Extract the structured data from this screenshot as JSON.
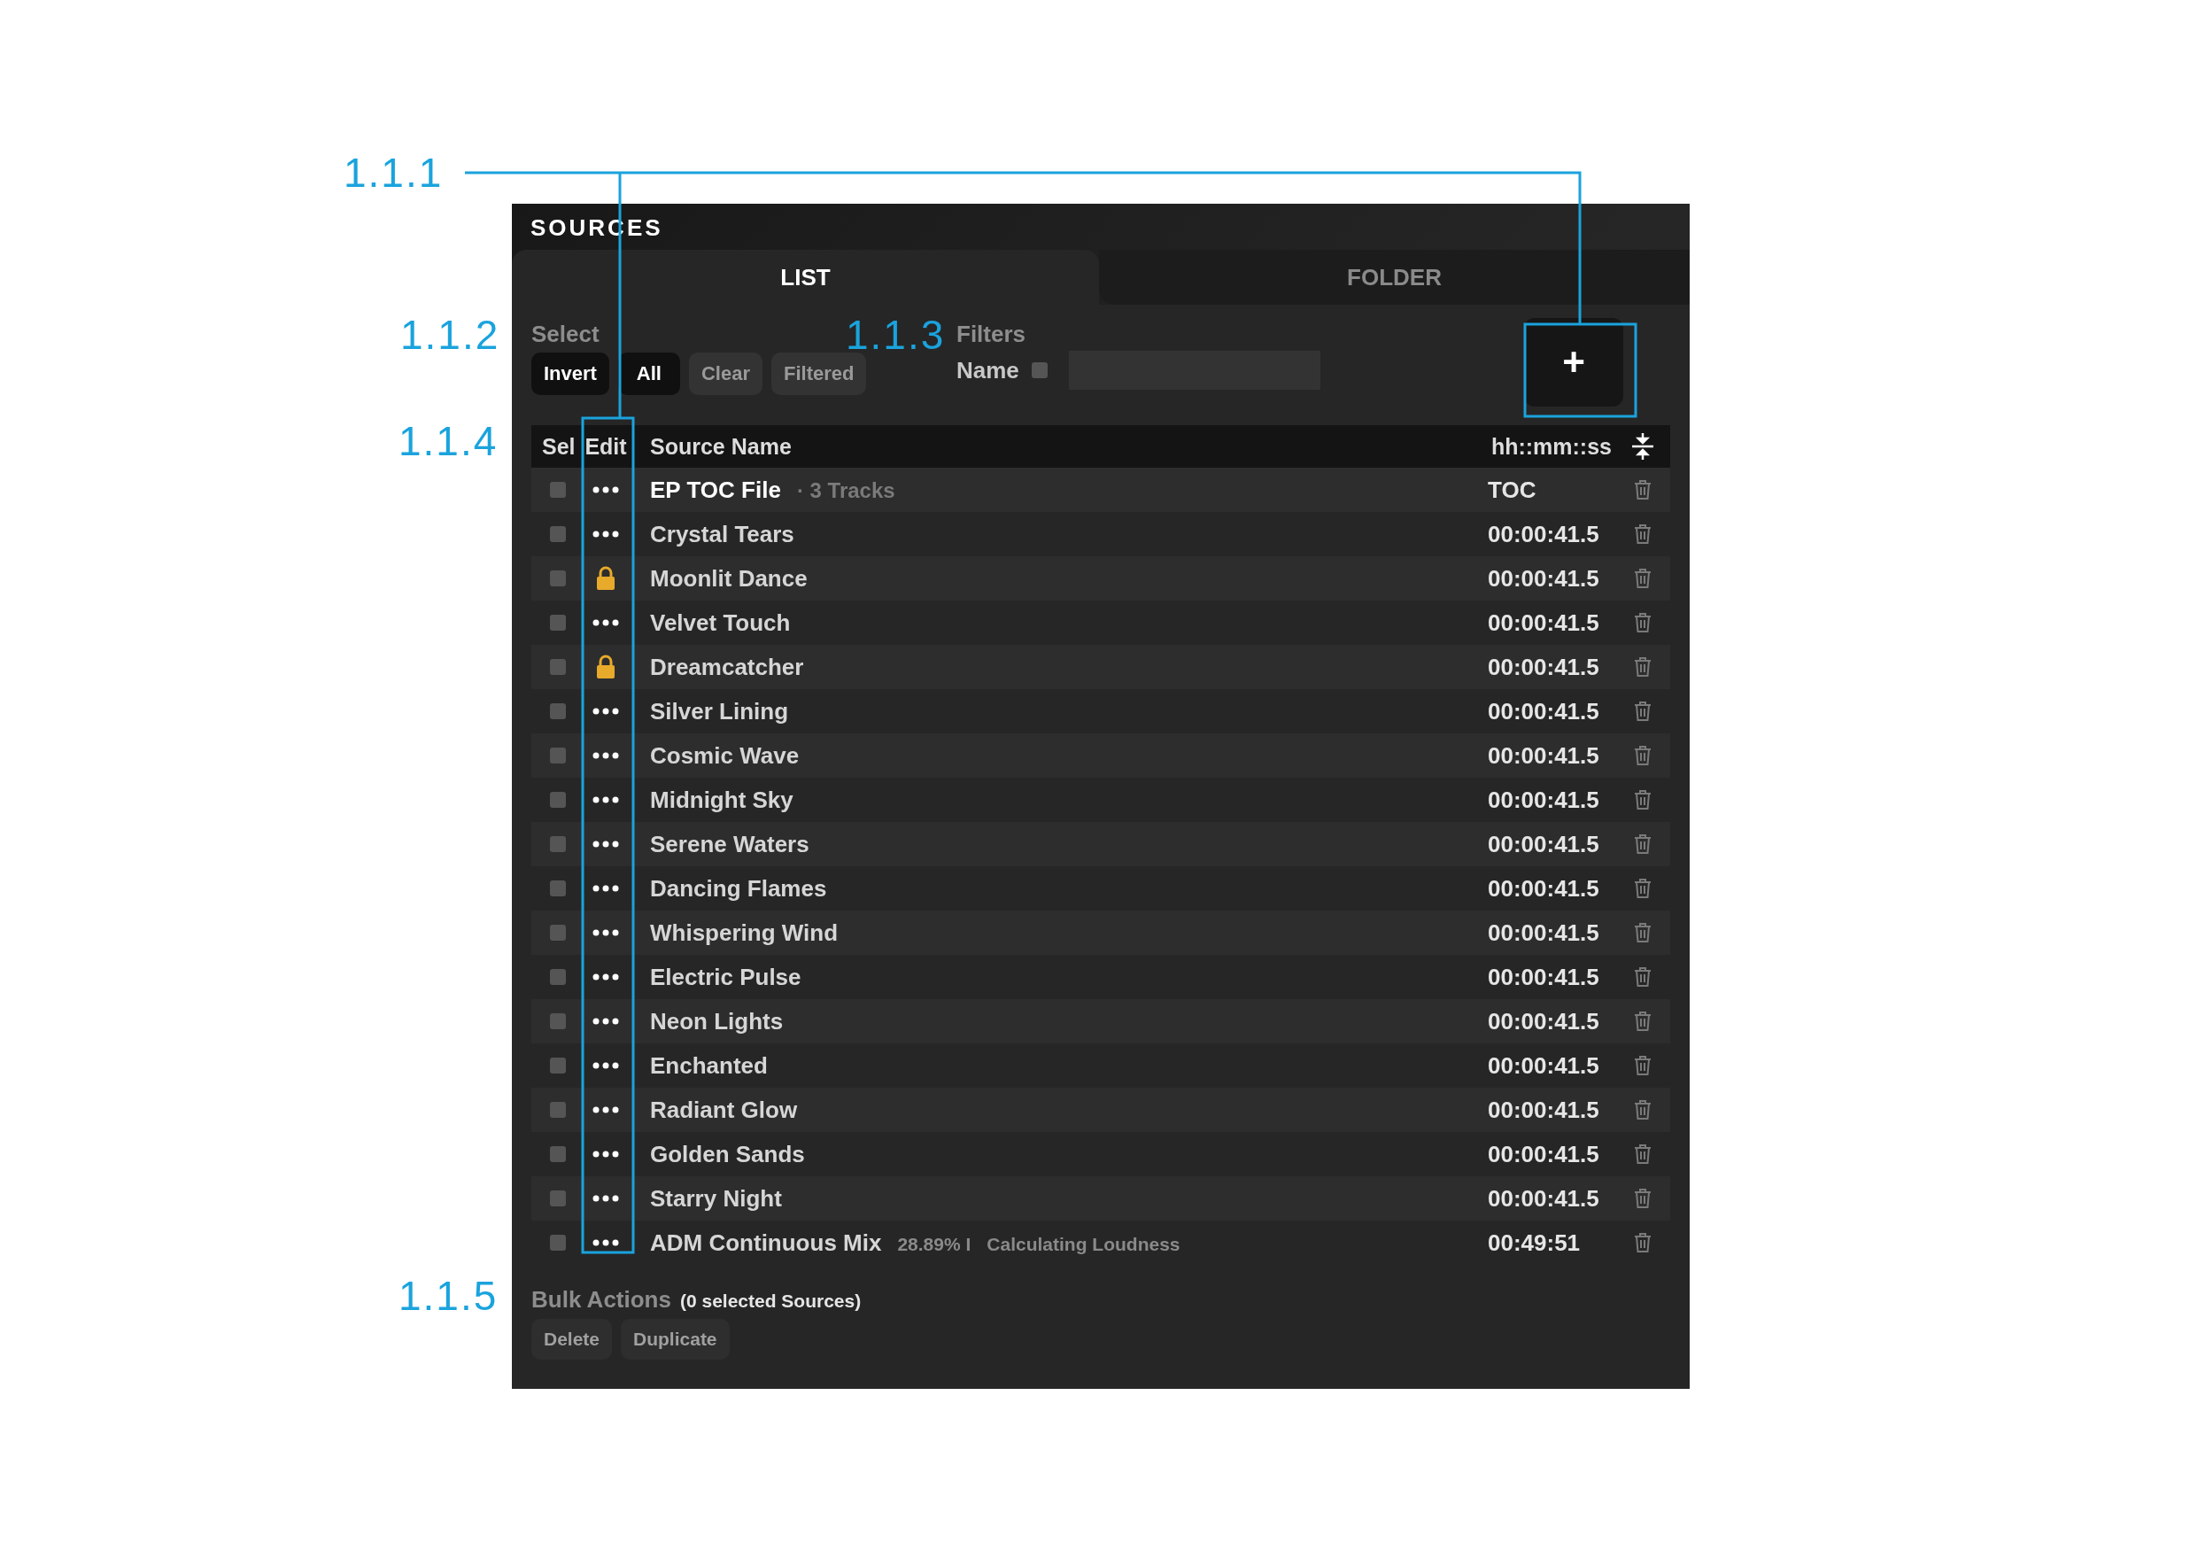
{
  "callouts": [
    {
      "label": "1.1.1"
    },
    {
      "label": "1.1.2"
    },
    {
      "label": "1.1.3"
    },
    {
      "label": "1.1.4"
    },
    {
      "label": "1.1.5"
    }
  ],
  "panel": {
    "title": "SOURCES"
  },
  "tabs": [
    {
      "label": "LIST",
      "selected": true
    },
    {
      "label": "FOLDER",
      "selected": false
    }
  ],
  "select": {
    "label": "Select",
    "buttons": [
      {
        "label": "Invert",
        "selected": true
      },
      {
        "label": "All",
        "selected": true
      },
      {
        "label": "Clear",
        "selected": false
      },
      {
        "label": "Filtered",
        "selected": false
      }
    ]
  },
  "filters": {
    "label": "Filters",
    "name_label": "Name",
    "name_checked": false
  },
  "add_button": {
    "label": "+"
  },
  "table": {
    "columns": [
      "Sel",
      "Edit",
      "Source Name",
      "hh::mm::ss"
    ],
    "rows": [
      {
        "name": "EP TOC File",
        "detail": "· 3 Tracks",
        "time": "TOC",
        "locked": false,
        "checked": false
      },
      {
        "name": "Crystal Tears",
        "time": "00:00:41.5",
        "locked": false,
        "checked": false
      },
      {
        "name": "Moonlit Dance",
        "time": "00:00:41.5",
        "locked": true,
        "checked": false
      },
      {
        "name": "Velvet Touch",
        "time": "00:00:41.5",
        "locked": false,
        "checked": false
      },
      {
        "name": "Dreamcatcher",
        "time": "00:00:41.5",
        "locked": true,
        "checked": false
      },
      {
        "name": "Silver Lining",
        "time": "00:00:41.5",
        "locked": false,
        "checked": false
      },
      {
        "name": "Cosmic Wave",
        "time": "00:00:41.5",
        "locked": false,
        "checked": false
      },
      {
        "name": "Midnight Sky",
        "time": "00:00:41.5",
        "locked": false,
        "checked": false
      },
      {
        "name": "Serene Waters",
        "time": "00:00:41.5",
        "locked": false,
        "checked": false
      },
      {
        "name": "Dancing Flames",
        "time": "00:00:41.5",
        "locked": false,
        "checked": false
      },
      {
        "name": "Whispering Wind",
        "time": "00:00:41.5",
        "locked": false,
        "checked": false
      },
      {
        "name": "Electric Pulse",
        "time": "00:00:41.5",
        "locked": false,
        "checked": false
      },
      {
        "name": "Neon Lights",
        "time": "00:00:41.5",
        "locked": false,
        "checked": false
      },
      {
        "name": "Enchanted",
        "time": "00:00:41.5",
        "locked": false,
        "checked": false
      },
      {
        "name": "Radiant Glow",
        "time": "00:00:41.5",
        "locked": false,
        "checked": false
      },
      {
        "name": "Golden Sands",
        "time": "00:00:41.5",
        "locked": false,
        "checked": false
      },
      {
        "name": "Starry Night",
        "time": "00:00:41.5",
        "locked": false,
        "checked": false
      },
      {
        "name": "ADM Continuous Mix",
        "progress": "28.89% I",
        "status": "Calculating Loudness",
        "time": "00:49:51",
        "locked": false,
        "checked": false
      }
    ]
  },
  "bulk": {
    "label": "Bulk Actions",
    "count": "(0 selected Sources)",
    "buttons": [
      "Delete",
      "Duplicate"
    ]
  }
}
